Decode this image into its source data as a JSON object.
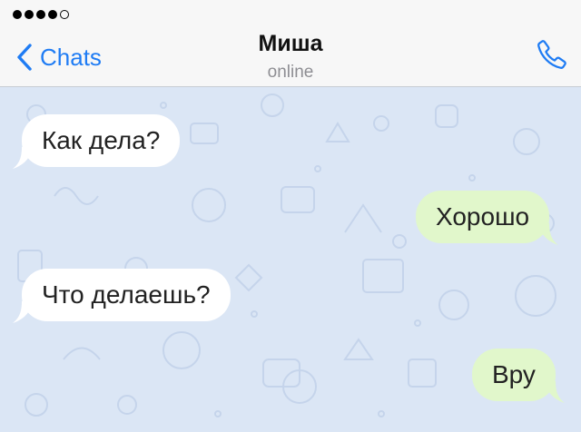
{
  "status_bar": {
    "signal_bars_filled": 4,
    "signal_bars_total": 5
  },
  "header": {
    "back_label": "Chats",
    "contact_name": "Миша",
    "contact_status": "online",
    "back_icon": "chevron-left-icon",
    "call_icon": "phone-icon"
  },
  "colors": {
    "accent": "#1f7cf4",
    "incoming_bubble": "#ffffff",
    "outgoing_bubble": "#e1f7cb",
    "chat_background": "#dbe6f5"
  },
  "messages": [
    {
      "direction": "incoming",
      "text": "Как дела?"
    },
    {
      "direction": "outgoing",
      "text": "Хорошо"
    },
    {
      "direction": "incoming",
      "text": "Что делаешь?"
    },
    {
      "direction": "outgoing",
      "text": "Вру"
    }
  ]
}
